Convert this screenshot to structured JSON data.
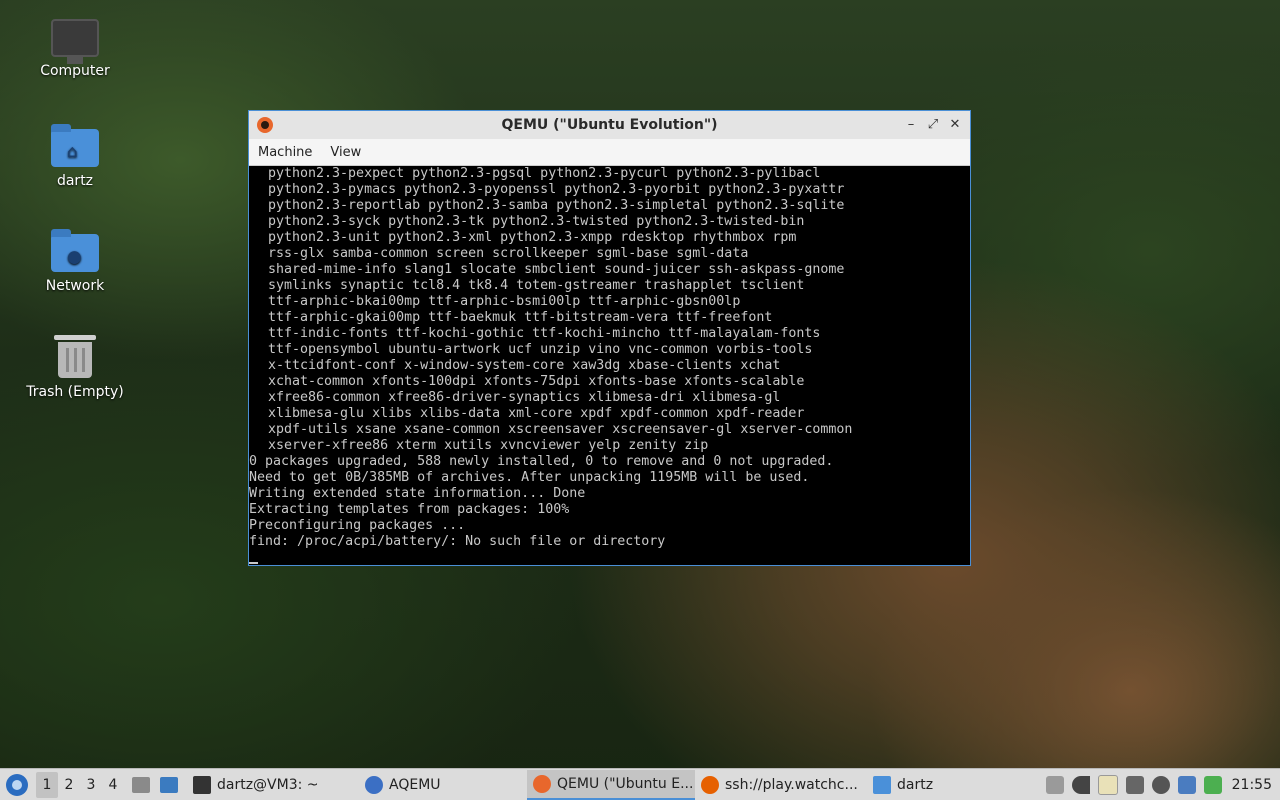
{
  "desktop": {
    "icons": [
      {
        "label": "Computer",
        "icon": "computer-icon"
      },
      {
        "label": "dartz",
        "icon": "home-folder-icon"
      },
      {
        "label": "Network",
        "icon": "network-folder-icon"
      },
      {
        "label": "Trash (Empty)",
        "icon": "trash-icon"
      }
    ]
  },
  "window": {
    "title": "QEMU (\"Ubuntu Evolution\")",
    "icon": "qemu-icon",
    "buttons": {
      "minimize": "–",
      "maximize": "⤢",
      "close": "✕"
    },
    "menu": [
      "Machine",
      "View"
    ]
  },
  "console": {
    "package_lines": [
      "python2.3-pexpect python2.3-pgsql python2.3-pycurl python2.3-pylibacl",
      "python2.3-pymacs python2.3-pyopenssl python2.3-pyorbit python2.3-pyxattr",
      "python2.3-reportlab python2.3-samba python2.3-simpletal python2.3-sqlite",
      "python2.3-syck python2.3-tk python2.3-twisted python2.3-twisted-bin",
      "python2.3-unit python2.3-xml python2.3-xmpp rdesktop rhythmbox rpm",
      "rss-glx samba-common screen scrollkeeper sgml-base sgml-data",
      "shared-mime-info slang1 slocate smbclient sound-juicer ssh-askpass-gnome",
      "symlinks synaptic tcl8.4 tk8.4 totem-gstreamer trashapplet tsclient",
      "ttf-arphic-bkai00mp ttf-arphic-bsmi00lp ttf-arphic-gbsn00lp",
      "ttf-arphic-gkai00mp ttf-baekmuk ttf-bitstream-vera ttf-freefont",
      "ttf-indic-fonts ttf-kochi-gothic ttf-kochi-mincho ttf-malayalam-fonts",
      "ttf-opensymbol ubuntu-artwork ucf unzip vino vnc-common vorbis-tools",
      "x-ttcidfont-conf x-window-system-core xaw3dg xbase-clients xchat",
      "xchat-common xfonts-100dpi xfonts-75dpi xfonts-base xfonts-scalable",
      "xfree86-common xfree86-driver-synaptics xlibmesa-dri xlibmesa-gl",
      "xlibmesa-glu xlibs xlibs-data xml-core xpdf xpdf-common xpdf-reader",
      "xpdf-utils xsane xsane-common xscreensaver xscreensaver-gl xserver-common",
      "xserver-xfree86 xterm xutils xvncviewer yelp zenity zip"
    ],
    "status_lines": [
      "0 packages upgraded, 588 newly installed, 0 to remove and 0 not upgraded.",
      "Need to get 0B/385MB of archives. After unpacking 1195MB will be used.",
      "Writing extended state information... Done",
      "Extracting templates from packages: 100%",
      "Preconfiguring packages ...",
      "find: /proc/acpi/battery/: No such file or directory"
    ]
  },
  "taskbar": {
    "workspaces": [
      "1",
      "2",
      "3",
      "4"
    ],
    "active_workspace": "1",
    "tasks": [
      {
        "label": "dartz@VM3: ~",
        "icon": "terminal-icon",
        "color": "#333333"
      },
      {
        "label": "AQEMU",
        "icon": "aqemu-icon",
        "color": "#3b6fc4"
      },
      {
        "label": "QEMU (\"Ubuntu E...",
        "icon": "qemu-icon",
        "color": "#e8672c",
        "active": true
      },
      {
        "label": "ssh://play.watchc...",
        "icon": "firefox-icon",
        "color": "#e66000"
      },
      {
        "label": "dartz",
        "icon": "folder-icon",
        "color": "#4a90d9"
      }
    ],
    "clock": "21:55",
    "colors": {
      "accent": "#4a8fd6",
      "background": "#dcdcdc"
    }
  }
}
